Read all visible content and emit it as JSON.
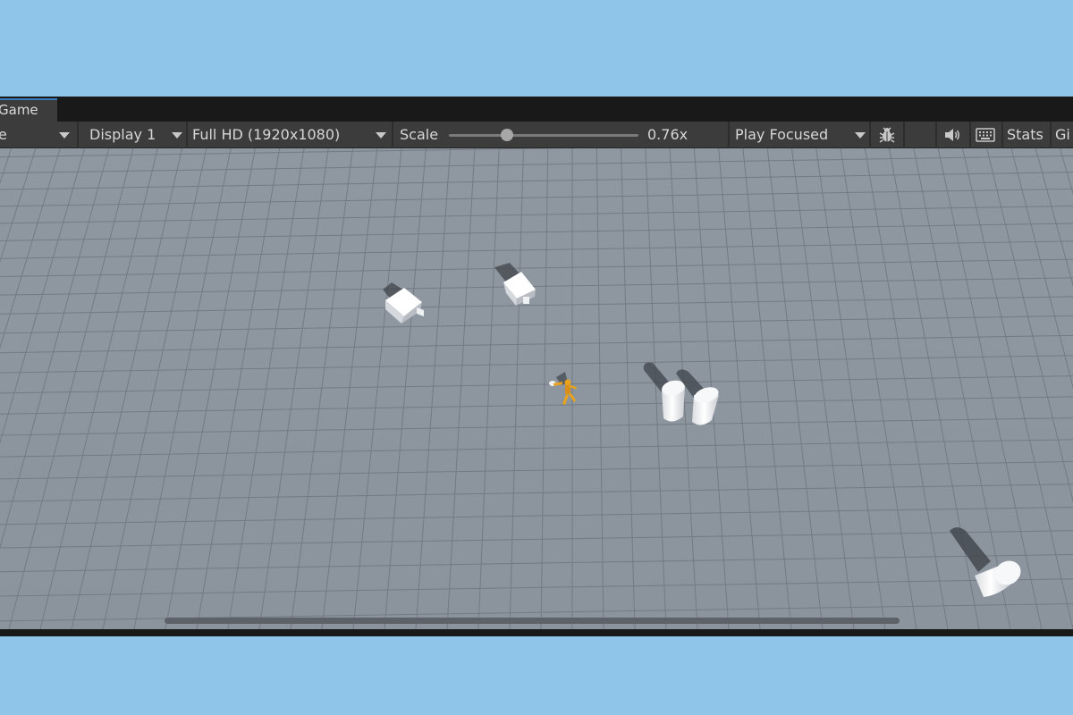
{
  "tab": {
    "label": "Game"
  },
  "toolbar": {
    "mode_fragment": "e",
    "display": "Display 1",
    "resolution": "Full HD (1920x1080)",
    "scale_label": "Scale",
    "scale_value": "0.76x",
    "play_mode": "Play Focused",
    "stats": "Stats",
    "gizmos_fragment": "Gi"
  },
  "icons": {
    "bug": "bug-icon",
    "audio": "speaker-icon",
    "keyboard": "keyboard-icon"
  },
  "colors": {
    "sky_background": "#8ec5e8",
    "editor_dark": "#191919",
    "toolbar": "#3c3c3c",
    "tab_accent": "#3a79bb",
    "ground": "#8e96a0",
    "character": "#e8a21c"
  },
  "scene": {
    "objects": [
      "cube",
      "cube",
      "cylinder",
      "cylinder",
      "cylinder",
      "character"
    ]
  }
}
